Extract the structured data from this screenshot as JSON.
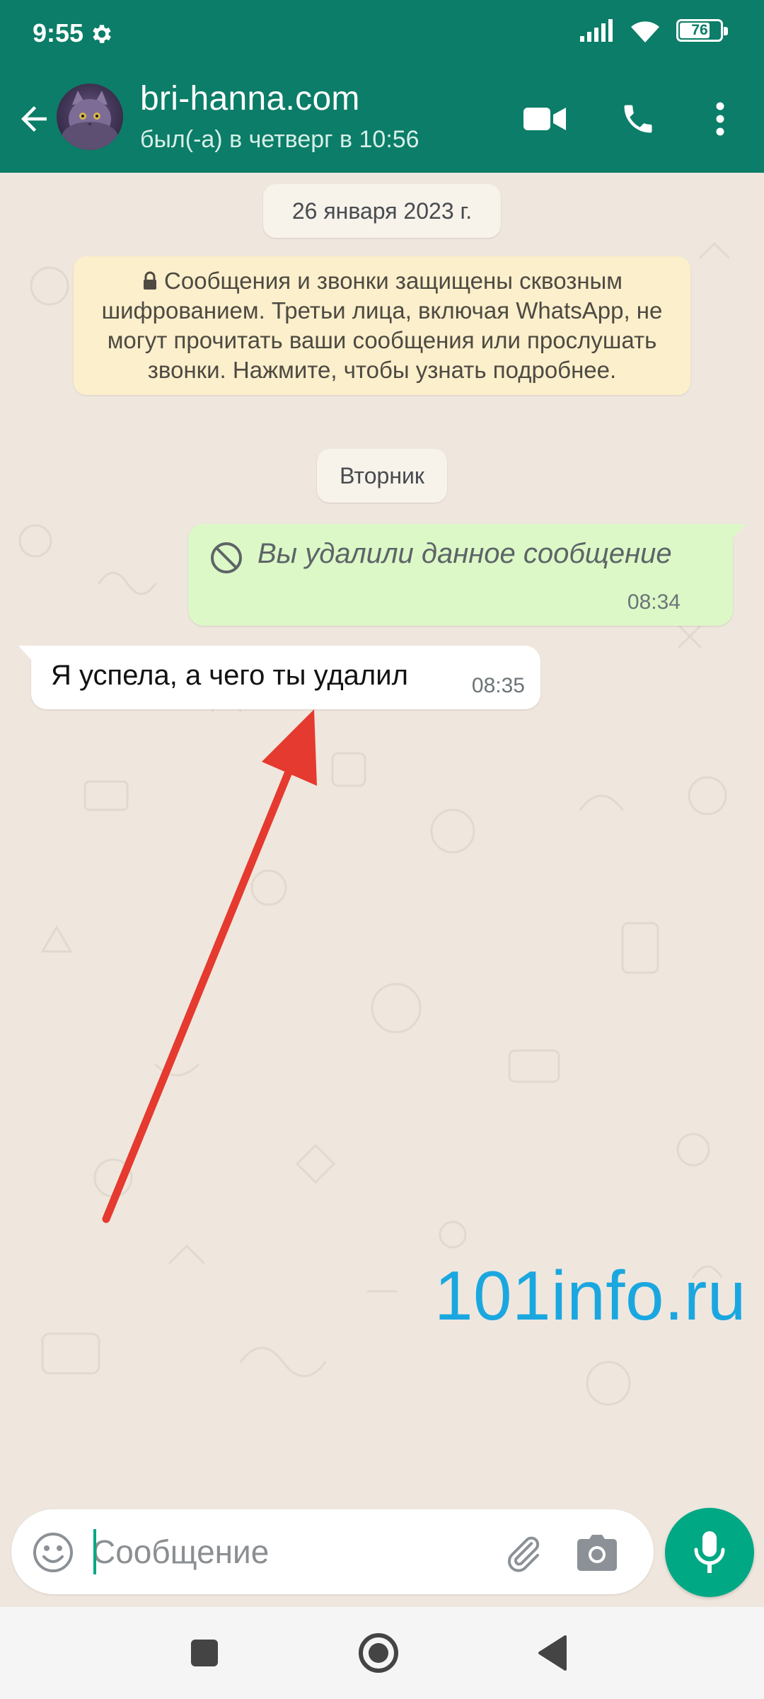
{
  "status_bar": {
    "time": "9:55",
    "battery": "76",
    "battery_level": 0.76,
    "icons": [
      "settings-gear-icon",
      "signal-icon",
      "wifi-icon",
      "battery-icon"
    ]
  },
  "header": {
    "contact_name": "bri-hanna.com",
    "last_seen": "был(-а) в четверг в 10:56",
    "icons": [
      "back-arrow-icon",
      "avatar",
      "video-call-icon",
      "voice-call-icon",
      "more-vert-icon"
    ]
  },
  "chat": {
    "date_chip": "26 января 2023 г.",
    "encryption_notice": "Сообщения и звонки защищены сквозным шифрованием. Третьи лица, включая WhatsApp, не могут прочитать ваши сообщения или прослушать звонки. Нажмите, чтобы узнать подробнее.",
    "day_chip": "Вторник",
    "messages": [
      {
        "direction": "outgoing",
        "deleted": true,
        "text": "Вы удалили данное сообщение",
        "time": "08:34"
      },
      {
        "direction": "incoming",
        "deleted": false,
        "text": "Я успела, а чего ты удалил",
        "time": "08:35"
      }
    ],
    "watermark": "101info.ru"
  },
  "composer": {
    "placeholder": "Сообщение",
    "value": "",
    "icons": [
      "emoji-icon",
      "attach-icon",
      "camera-icon",
      "mic-icon"
    ],
    "accent_color": "#00a884"
  },
  "nav_bar": {
    "buttons": [
      "recents-square-icon",
      "home-circle-icon",
      "back-triangle-icon"
    ]
  },
  "colors": {
    "header": "#0b7d68",
    "chat_background": "#efe7de",
    "outgoing_bubble": "#dcf8c6",
    "incoming_bubble": "#ffffff",
    "notice_background": "#fcefcc",
    "watermark": "#1aa7e0",
    "annotation_arrow": "#e53a2f"
  }
}
